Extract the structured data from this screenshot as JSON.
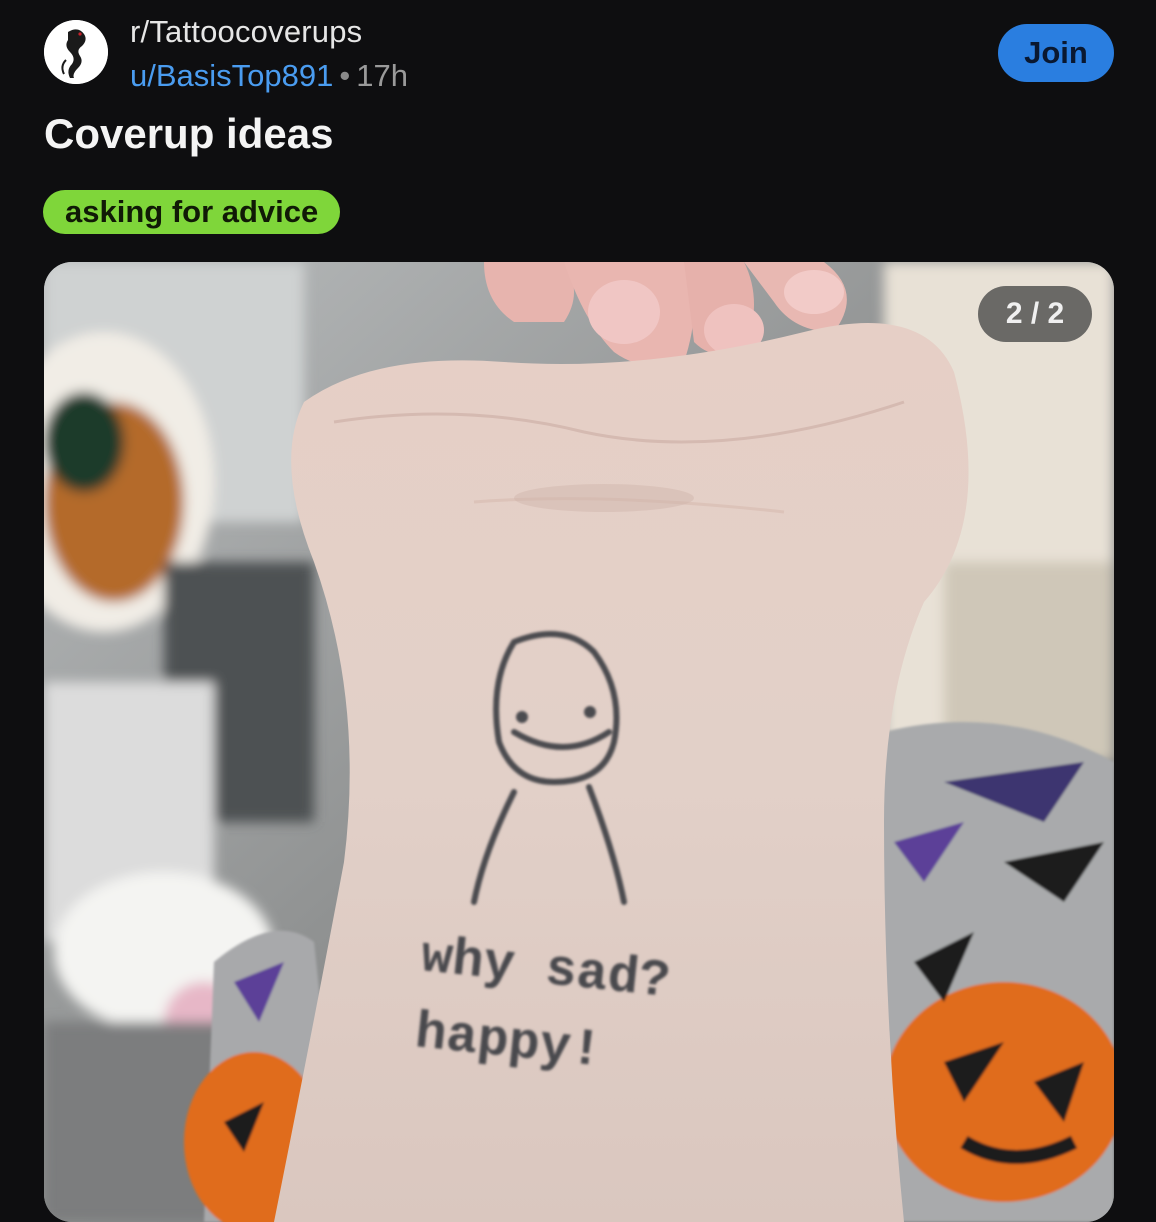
{
  "header": {
    "subreddit": "r/Tattoocoverups",
    "username": "u/BasisTop891",
    "separator": "•",
    "time_ago": "17h",
    "join_label": "Join",
    "avatar_icon": "panther-avatar-icon"
  },
  "post": {
    "title": "Coverup ideas",
    "flair": "asking for advice",
    "flair_color": "#7fd63a"
  },
  "media": {
    "counter": "2 / 2",
    "tattoo_text_line1": "why sad?",
    "tattoo_text_line2": "happy!"
  },
  "colors": {
    "background": "#0e0e10",
    "accent": "#2a7ee0",
    "username": "#4a9cf0"
  }
}
